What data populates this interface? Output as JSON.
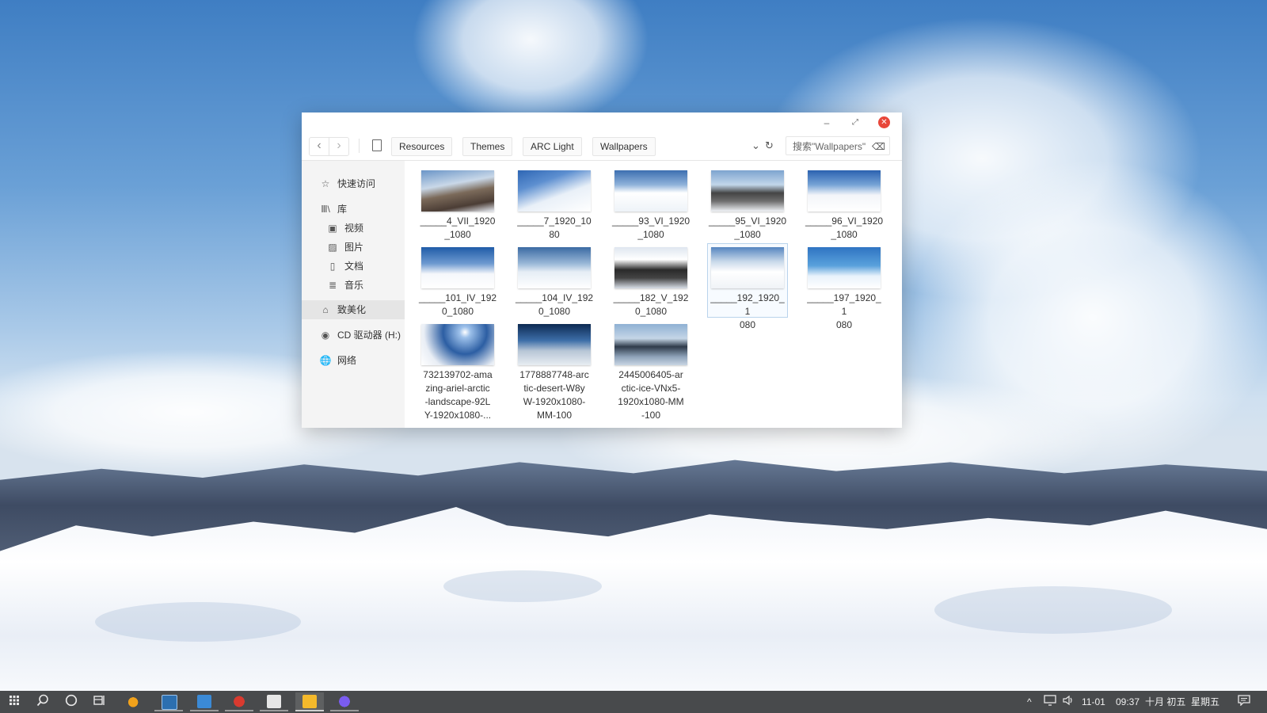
{
  "window": {
    "controls": {
      "minimize": "–",
      "maximize": "⤢",
      "close": "✕"
    }
  },
  "toolbar": {
    "back": "‹",
    "forward": "›",
    "breadcrumbs": [
      "Resources",
      "Themes",
      "ARC Light",
      "Wallpapers"
    ],
    "view_icon": "⌄",
    "refresh_icon": "↻",
    "search_placeholder": "搜索\"Wallpapers\"",
    "search_clear_icon": "⌫"
  },
  "sidebar": {
    "quick_access": {
      "icon": "star-icon",
      "glyph": "☆",
      "label": "快速访问"
    },
    "library": {
      "icon": "library-icon",
      "glyph": "Ⅲ\\",
      "label": "库"
    },
    "library_items": [
      {
        "icon": "video-icon",
        "glyph": "▣",
        "label": "视频"
      },
      {
        "icon": "image-icon",
        "glyph": "▨",
        "label": "图片"
      },
      {
        "icon": "document-icon",
        "glyph": "▯",
        "label": "文档"
      },
      {
        "icon": "music-icon",
        "glyph": "≣",
        "label": "音乐"
      }
    ],
    "computer": {
      "icon": "laptop-icon",
      "glyph": "⌂",
      "label": "致美化"
    },
    "cd_drive": {
      "icon": "disc-icon",
      "glyph": "◉",
      "label": "CD 驱动器 (H:)"
    },
    "network": {
      "icon": "globe-icon",
      "glyph": "🌐",
      "label": "网络"
    }
  },
  "files": [
    {
      "name": "_____4_VII_1920\n_1080",
      "selected": false
    },
    {
      "name": "_____7_1920_10\n80",
      "selected": false
    },
    {
      "name": "_____93_VI_1920\n_1080",
      "selected": false
    },
    {
      "name": "_____95_VI_1920\n_1080",
      "selected": false
    },
    {
      "name": "_____96_VI_1920\n_1080",
      "selected": false
    },
    {
      "name": "_____101_IV_192\n0_1080",
      "selected": false
    },
    {
      "name": "_____104_IV_192\n0_1080",
      "selected": false
    },
    {
      "name": "_____182_V_192\n0_1080",
      "selected": false
    },
    {
      "name": "_____192_1920_1\n080",
      "selected": true
    },
    {
      "name": "_____197_1920_1\n080",
      "selected": false
    },
    {
      "name": "732139702-ama\nzing-ariel-arctic\n-landscape-92L\nY-1920x1080-...",
      "selected": false
    },
    {
      "name": "1778887748-arc\ntic-desert-W8y\nW-1920x1080-\nMM-100",
      "selected": false
    },
    {
      "name": "2445006405-ar\nctic-ice-VNx5-\n1920x1080-MM\n-100",
      "selected": false
    }
  ],
  "taskbar": {
    "start_icon": "apps-grid-icon",
    "search_icon": "search-icon",
    "cortana_icon": "circle-icon",
    "taskview_icon": "task-view-icon",
    "apps": [
      {
        "name": "app-1",
        "icon": "app-orange-icon",
        "color": "#f2a21b"
      },
      {
        "name": "app-2",
        "icon": "photoshop-icon",
        "color": "#2c6fb0"
      },
      {
        "name": "app-3",
        "icon": "window-icon",
        "color": "#3b8ad6"
      },
      {
        "name": "app-4",
        "icon": "netease-music-icon",
        "color": "#d93a2f"
      },
      {
        "name": "app-5",
        "icon": "notepad-icon",
        "color": "#e6e6e6"
      },
      {
        "name": "app-6",
        "icon": "file-explorer-icon",
        "color": "#f4b92b"
      },
      {
        "name": "app-7",
        "icon": "chrome-icon",
        "color": "#7a5cf0"
      }
    ],
    "tray": {
      "chevron": "^",
      "network_icon": "network-icon",
      "volume_icon": "volume-icon",
      "date": "11-01",
      "time": "09:37",
      "lunar": "十月 初五",
      "weekday": "星期五",
      "notification_icon": "notification-icon"
    }
  }
}
